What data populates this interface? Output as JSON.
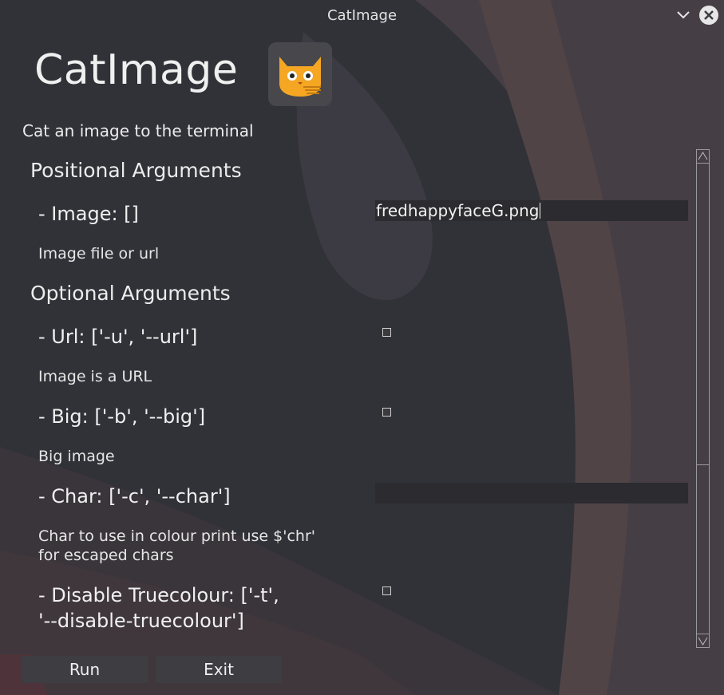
{
  "window": {
    "title": "CatImage"
  },
  "app": {
    "name": "CatImage",
    "description": "Cat an image to the terminal"
  },
  "positional": {
    "heading": "Positional Arguments",
    "image": {
      "label": "- Image: []",
      "help": "Image file or url",
      "value": "fredhappyfaceG.png"
    }
  },
  "optional": {
    "heading": "Optional Arguments",
    "url": {
      "label": "- Url: ['-u', '--url']",
      "help": "Image is a URL",
      "checked": false
    },
    "big": {
      "label": "- Big: ['-b', '--big']",
      "help": "Big image",
      "checked": false
    },
    "char": {
      "label": "- Char: ['-c', '--char']",
      "help_line1": "Char to use in colour print use $'chr'",
      "help_line2": "for escaped chars",
      "value": ""
    },
    "truecolour": {
      "label_line1": "- Disable Truecolour: ['-t',",
      "label_line2": "'--disable-truecolour']",
      "checked": false
    }
  },
  "buttons": {
    "run": "Run",
    "exit": "Exit"
  },
  "icons": {
    "minimize": "chevron-down-icon",
    "close": "close-icon",
    "logo": "cat-logo-icon",
    "scroll_up": "arrow-up-icon",
    "scroll_down": "arrow-down-icon"
  }
}
